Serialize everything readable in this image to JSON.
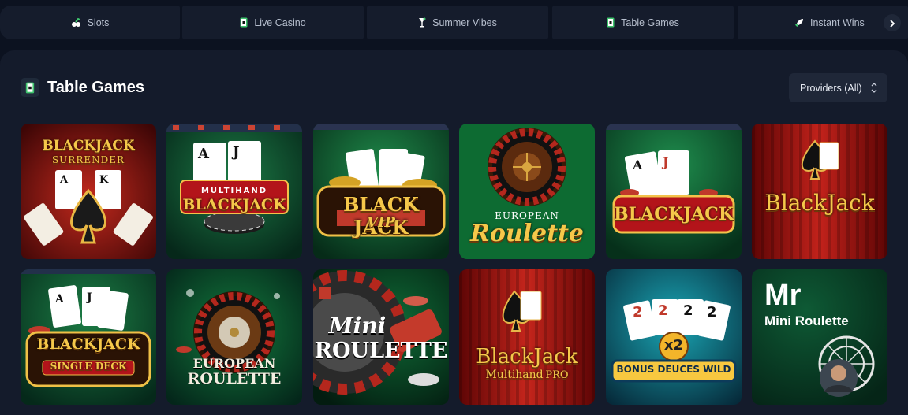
{
  "category_tabs": [
    {
      "label": "Slots",
      "icon": "slots-icon"
    },
    {
      "label": "Live Casino",
      "icon": "live-casino-icon"
    },
    {
      "label": "Summer Vibes",
      "icon": "summer-vibes-icon"
    },
    {
      "label": "Table Games",
      "icon": "table-games-icon"
    },
    {
      "label": "Instant Wins",
      "icon": "rocket-icon"
    }
  ],
  "section": {
    "title": "Table Games",
    "providers_label": "Providers (All)"
  },
  "games": [
    {
      "line1": "BLACKJACK",
      "line2": "SURRENDER"
    },
    {
      "line1": "MULTIHAND",
      "line2": "BLACKJACK"
    },
    {
      "line1": "BLACK JACK",
      "line2": "VIP"
    },
    {
      "line1": "EUROPEAN",
      "line2": "Roulette"
    },
    {
      "line1": "BLACKJACK"
    },
    {
      "line1": "BlackJack"
    },
    {
      "line1": "BLACKJACK",
      "line2": "SINGLE DECK"
    },
    {
      "line1": "EUROPEAN",
      "line2": "ROULETTE"
    },
    {
      "line1": "Mini",
      "line2": "ROULETTE"
    },
    {
      "line1": "BlackJack",
      "line2": "Multihand",
      "line3": "PRO"
    },
    {
      "line1": "x2",
      "line2": "BONUS DEUCES WILD"
    },
    {
      "line1": "Mr",
      "line2": "Mini Roulette"
    }
  ],
  "colors": {
    "background": "#0c1220",
    "panel": "#141b2b",
    "tab": "#151c2c",
    "accent_gold": "#f5c84a"
  }
}
